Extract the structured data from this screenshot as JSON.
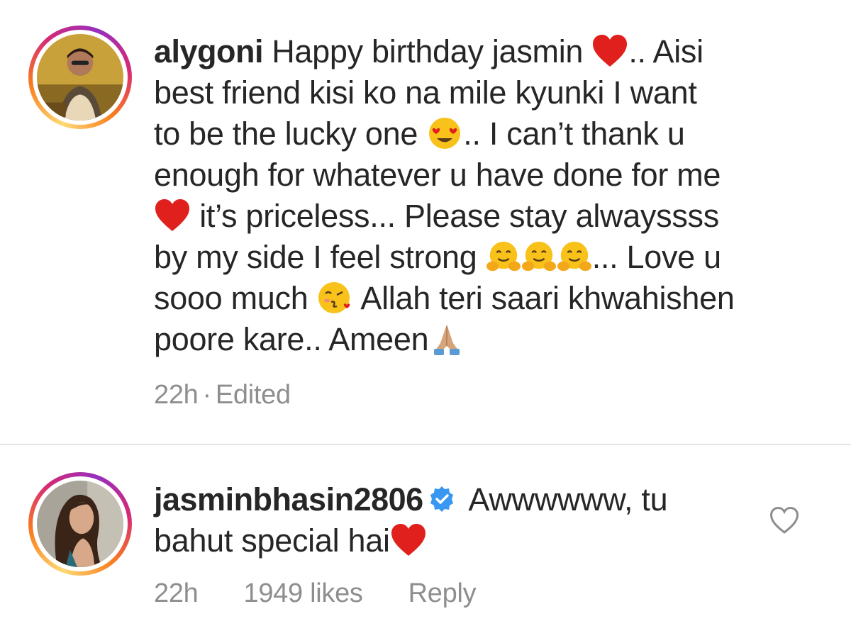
{
  "comments": [
    {
      "username": "alygoni",
      "lines": [
        {
          "a": "Happy birthday jasmin",
          "b": ".. Aisi"
        },
        {
          "a": "best friend kisi ko na mile kyunki I want"
        },
        {
          "a": "to be the lucky one",
          "b": ".. I can’t thank u"
        },
        {
          "a": "enough for whatever u have done for me"
        },
        {
          "a": "it’s priceless... Please stay alwayssss"
        },
        {
          "a": "by my side I feel strong",
          "b": "... Love u"
        },
        {
          "a": "sooo much",
          "b": "Allah teri saari khwahishen"
        },
        {
          "a": "poore kare.. Ameen"
        }
      ],
      "time": "22h",
      "separator": "·",
      "edited": "Edited"
    },
    {
      "username": "jasminbhasin2806",
      "lines": [
        {
          "a": "Awwwwww, tu"
        },
        {
          "a": "bahut special hai"
        }
      ],
      "time": "22h",
      "likes": "1949 likes",
      "reply": "Reply",
      "verified": true
    }
  ],
  "icons": {
    "heart": "red-heart-icon",
    "heart_eyes": "heart-eyes-emoji-icon",
    "hugging": "hugging-face-emoji-icon",
    "kiss": "face-blowing-kiss-emoji-icon",
    "pray": "folded-hands-emoji-icon",
    "verified": "verified-badge-icon",
    "like": "heart-outline-icon"
  },
  "colors": {
    "text": "#262626",
    "meta": "#8e8e8e",
    "verified": "#3897f0",
    "heart": "#e0201c",
    "divider": "#e4e4e4"
  }
}
